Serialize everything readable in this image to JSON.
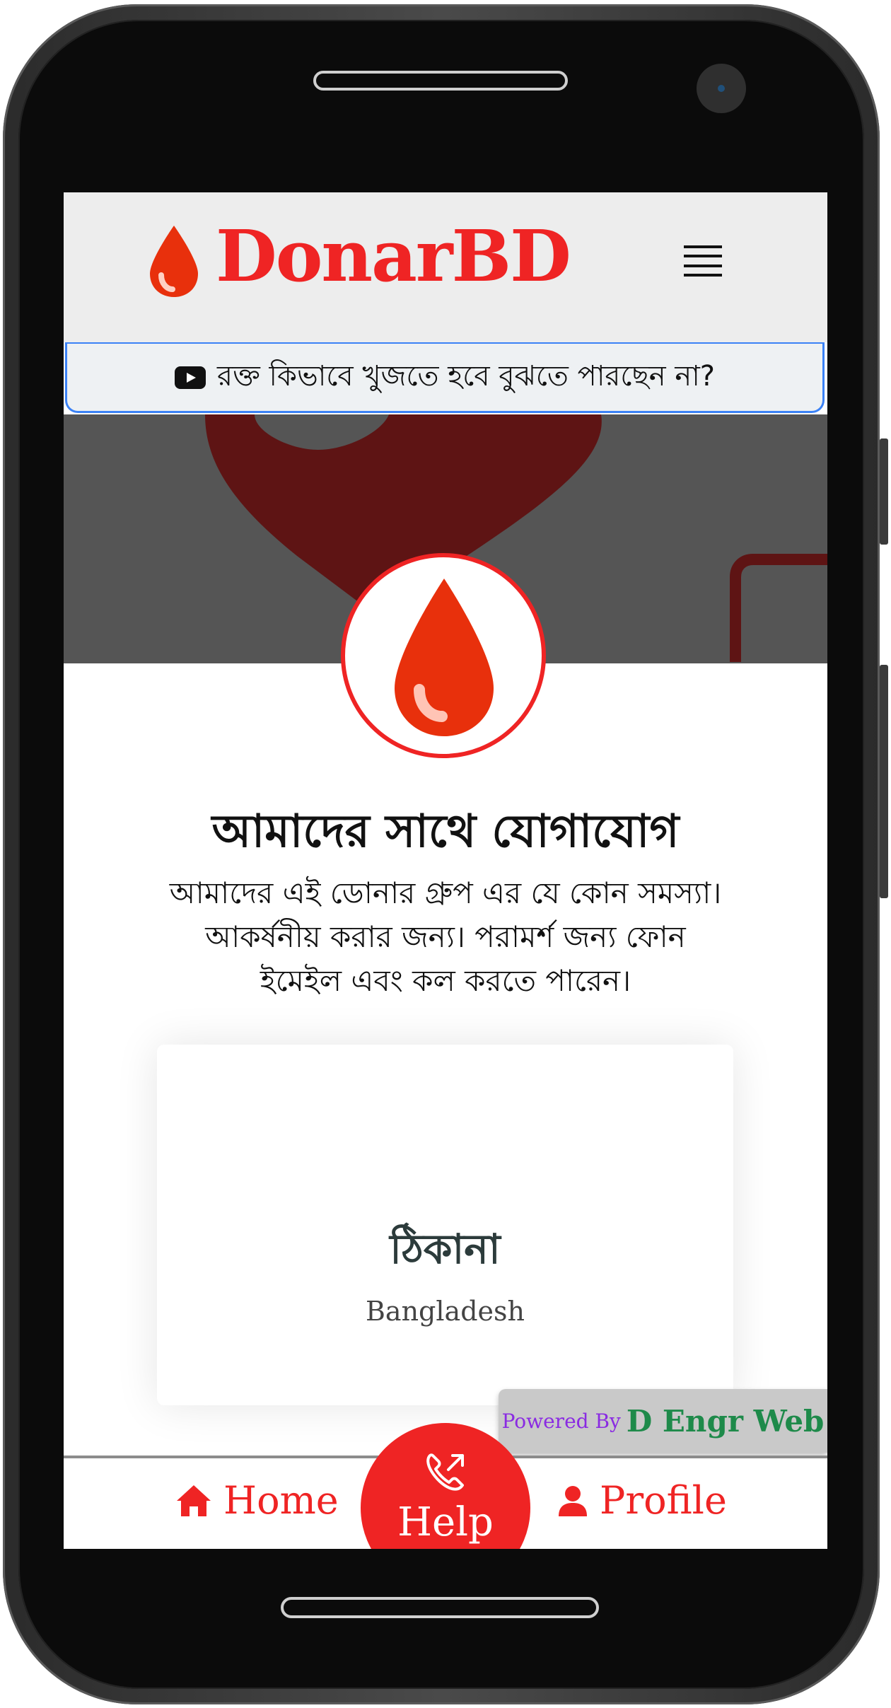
{
  "app": {
    "brand": "DonarBD"
  },
  "notice": {
    "text": "রক্ত কিভাবে খুজতে হবে বুঝতে পারছেন না?",
    "icon": "youtube-icon"
  },
  "contact": {
    "title": "আমাদের সাথে যোগাযোগ",
    "description": "আমাদের এই ডোনার গ্রুপ এর যে কোন সমস্যা। আকর্ষনীয় করার জন্য। পরামর্শ জন্য ফোন ইমেইল এবং কল করতে পারেন।"
  },
  "address_card": {
    "title": "ঠিকানা",
    "value": "Bangladesh"
  },
  "footer": {
    "powered_label": "Powered By",
    "powered_brand": "D Engr Web"
  },
  "bottom_nav": {
    "home": "Home",
    "help": "Help",
    "profile": "Profile"
  },
  "colors": {
    "brand_red": "#ef2424",
    "banner_gray": "#555555",
    "notice_border": "#3b82f6"
  }
}
